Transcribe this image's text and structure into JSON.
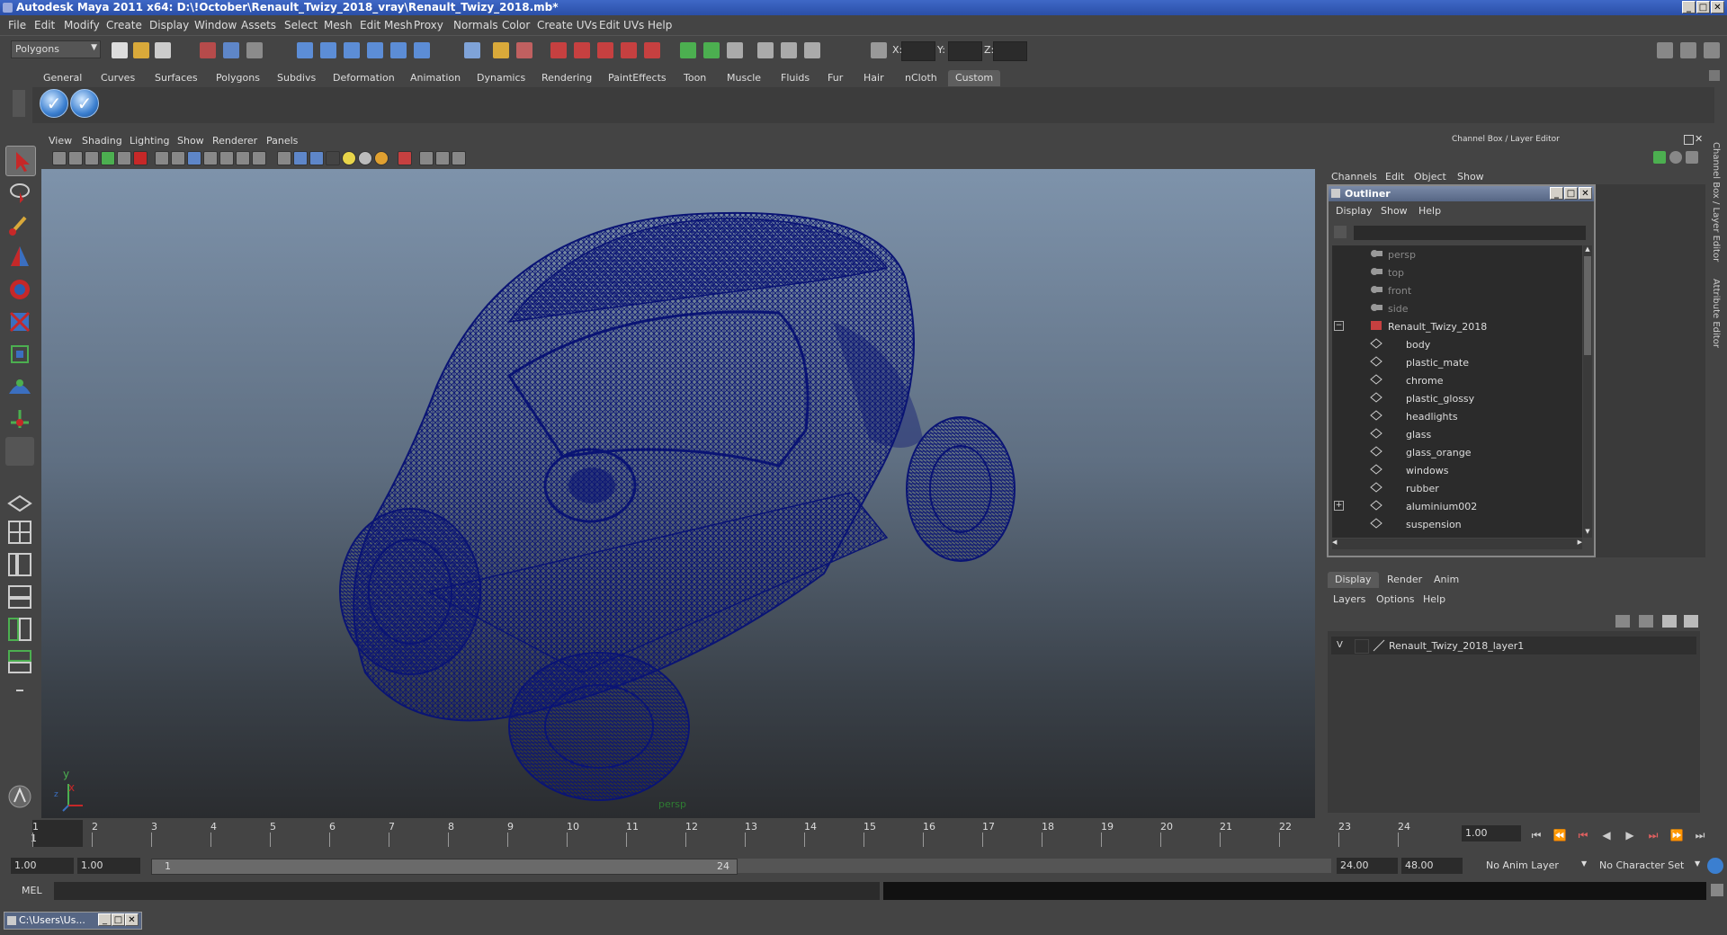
{
  "window": {
    "title": "Autodesk Maya 2011 x64: D:\\!October\\Renault_Twizy_2018_vray\\Renault_Twizy_2018.mb*"
  },
  "menubar": [
    "File",
    "Edit",
    "Modify",
    "Create",
    "Display",
    "Window",
    "Assets",
    "Select",
    "Mesh",
    "Edit Mesh",
    "Proxy",
    "Normals",
    "Color",
    "Create UVs",
    "Edit UVs",
    "Help"
  ],
  "status_line": {
    "mode": "Polygons",
    "x_label": "X:",
    "y_label": "Y:",
    "z_label": "Z:"
  },
  "shelf_tabs": [
    "General",
    "Curves",
    "Surfaces",
    "Polygons",
    "Subdivs",
    "Deformation",
    "Animation",
    "Dynamics",
    "Rendering",
    "PaintEffects",
    "Toon",
    "Muscle",
    "Fluids",
    "Fur",
    "Hair",
    "nCloth",
    "Custom"
  ],
  "active_shelf": "Custom",
  "viewport": {
    "menus": [
      "View",
      "Shading",
      "Lighting",
      "Show",
      "Renderer",
      "Panels"
    ],
    "camera": "persp",
    "axis_y": "y",
    "axis_x": "x",
    "axis_z": "z",
    "wire_color": "#0a1474"
  },
  "right_panel": {
    "header": "Channel Box / Layer Editor",
    "channel_menus": [
      "Channels",
      "Edit",
      "Object",
      "Show"
    ],
    "side_tabs": [
      "Channel Box / Layer Editor",
      "Attribute Editor"
    ]
  },
  "outliner": {
    "title": "Outliner",
    "menus": [
      "Display",
      "Show",
      "Help"
    ],
    "items": [
      {
        "label": "persp",
        "kind": "camera",
        "dim": true
      },
      {
        "label": "top",
        "kind": "camera",
        "dim": true
      },
      {
        "label": "front",
        "kind": "camera",
        "dim": true
      },
      {
        "label": "side",
        "kind": "camera",
        "dim": true
      },
      {
        "label": "Renault_Twizy_2018",
        "kind": "group",
        "dim": false
      },
      {
        "label": "body",
        "kind": "mesh",
        "dim": false
      },
      {
        "label": "plastic_mate",
        "kind": "mesh",
        "dim": false
      },
      {
        "label": "chrome",
        "kind": "mesh",
        "dim": false
      },
      {
        "label": "plastic_glossy",
        "kind": "mesh",
        "dim": false
      },
      {
        "label": "headlights",
        "kind": "mesh",
        "dim": false
      },
      {
        "label": "glass",
        "kind": "mesh",
        "dim": false
      },
      {
        "label": "glass_orange",
        "kind": "mesh",
        "dim": false
      },
      {
        "label": "windows",
        "kind": "mesh",
        "dim": false
      },
      {
        "label": "rubber",
        "kind": "mesh",
        "dim": false
      },
      {
        "label": "aluminium002",
        "kind": "mesh",
        "dim": false
      },
      {
        "label": "suspension",
        "kind": "mesh",
        "dim": false
      }
    ]
  },
  "layer_editor": {
    "tabs": [
      "Display",
      "Render",
      "Anim"
    ],
    "menus": [
      "Layers",
      "Options",
      "Help"
    ],
    "layer_visibility": "V",
    "layer_name": "Renault_Twizy_2018_layer1"
  },
  "timeline": {
    "ticks": [
      "1",
      "2",
      "3",
      "4",
      "5",
      "6",
      "7",
      "8",
      "9",
      "10",
      "11",
      "12",
      "13",
      "14",
      "15",
      "16",
      "17",
      "18",
      "19",
      "20",
      "21",
      "22",
      "23",
      "24"
    ],
    "current_frame_marker": "1",
    "current_frame": "1.00"
  },
  "range": {
    "start": "1.00",
    "inner_start": "1.00",
    "slider_start": "1",
    "slider_end": "24",
    "end": "24.00",
    "outer_end": "48.00",
    "anim_layer": "No Anim Layer",
    "character_set": "No Character Set"
  },
  "command_line": {
    "label": "MEL"
  },
  "taskbar": {
    "item": "C:\\Users\\Us..."
  }
}
